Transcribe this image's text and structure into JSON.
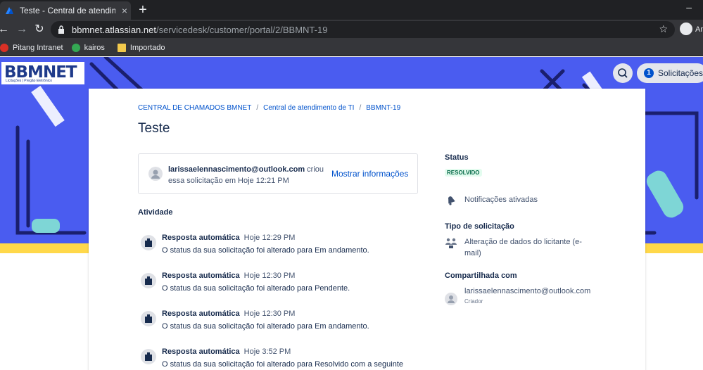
{
  "browser": {
    "tab_title": "Teste - Central de atendimento d",
    "tab_close": "×",
    "new_tab": "+",
    "minimize": "–",
    "url_host": "bbmnet.atlassian.net",
    "url_path": "/servicedesk/customer/portal/2/BBMNT-19",
    "profile_label": "An",
    "nav": {
      "back": "←",
      "forward": "→",
      "reload": "↻"
    },
    "star": "☆",
    "bookmarks": [
      {
        "label": "Pitang Intranet",
        "color": "#d93025"
      },
      {
        "label": "kairos",
        "color": "#34a853"
      },
      {
        "label": "Importado",
        "color": "#f2c94c"
      }
    ]
  },
  "header": {
    "logo_text": "BBMNET",
    "logo_sub": "Licitações | Pregão Eletrônico",
    "requests_count": "1",
    "requests_label": "Solicitações"
  },
  "breadcrumb": [
    "CENTRAL DE CHAMADOS BMNET",
    "Central de atendimento de TI",
    "BBMNT-19"
  ],
  "breadcrumb_sep": "/",
  "title": "Teste",
  "creator": {
    "email": "larissaelennascimento@outlook.com",
    "action_suffix": " criou essa solicitação em Hoje 12:21 PM",
    "more_info": "Mostrar informações"
  },
  "activity": {
    "title": "Atividade",
    "items": [
      {
        "who": "Resposta automática",
        "when": "Hoje 12:29 PM",
        "text": "O status da sua solicitação foi alterado para Em andamento."
      },
      {
        "who": "Resposta automática",
        "when": "Hoje 12:30 PM",
        "text": "O status da sua solicitação foi alterado para Pendente."
      },
      {
        "who": "Resposta automática",
        "when": "Hoje 12:30 PM",
        "text": "O status da sua solicitação foi alterado para Em andamento."
      },
      {
        "who": "Resposta automática",
        "when": "Hoje 3:52 PM",
        "text": "O status da sua solicitação foi alterado para Resolvido com a seguinte"
      }
    ]
  },
  "sidebar": {
    "status_label": "Status",
    "status_value": "RESOLVIDO",
    "notifications": "Notificações ativadas",
    "type_label": "Tipo de solicitação",
    "type_value": "Alteração de dados do licitante (e-mail)",
    "shared_label": "Compartilhada com",
    "shared_email": "larissaelennascimento@outlook.com",
    "shared_role": "Criador"
  },
  "colors": {
    "banner": "#4a5cf0",
    "banner_stripe": "#ffd84a",
    "link": "#0052cc",
    "status_bg": "#e3fcef",
    "status_fg": "#006644"
  }
}
